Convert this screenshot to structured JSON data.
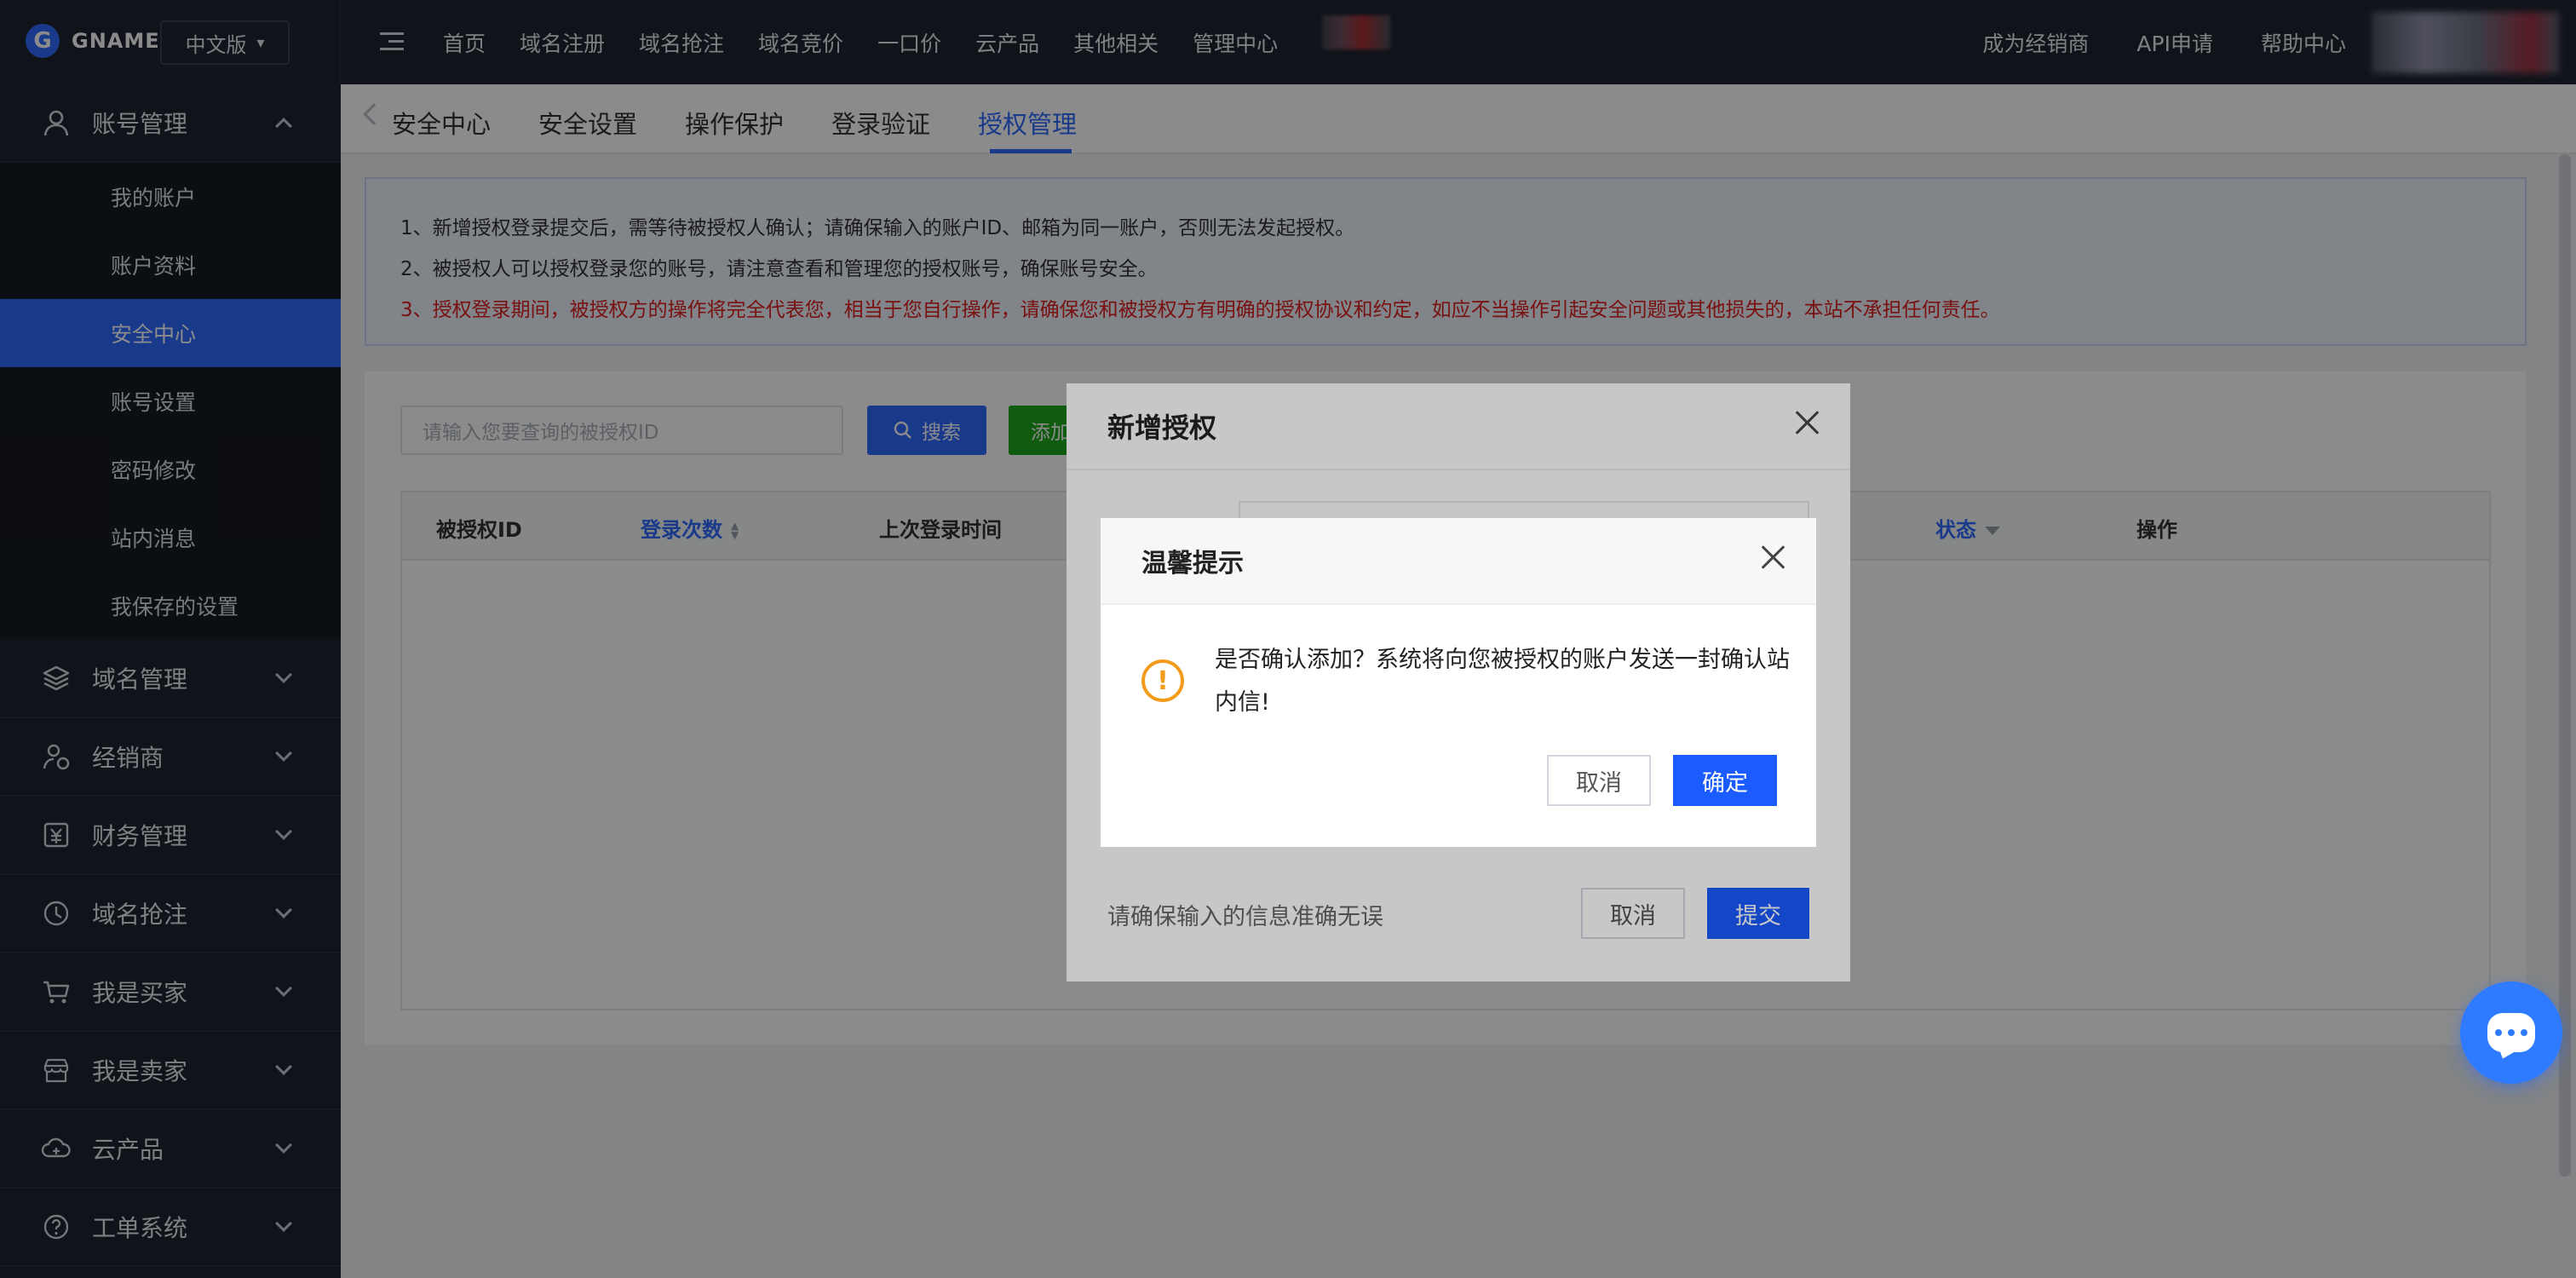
{
  "brand": {
    "logo_letter": "G",
    "name": "GNAME"
  },
  "language": {
    "selected": "中文版"
  },
  "topnav": {
    "items": [
      "首页",
      "域名注册",
      "域名抢注",
      "域名竞价",
      "一口价",
      "云产品",
      "其他相关",
      "管理中心"
    ],
    "right_items": [
      "成为经销商",
      "API申请",
      "帮助中心"
    ]
  },
  "sidebar": {
    "account_group": "账号管理",
    "sub_items": [
      "我的账户",
      "账户资料",
      "安全中心",
      "账号设置",
      "密码修改",
      "站内消息",
      "我保存的设置"
    ],
    "active_sub": "安全中心",
    "groups": [
      "域名管理",
      "经销商",
      "财务管理",
      "域名抢注",
      "我是买家",
      "我是卖家",
      "云产品",
      "工单系统"
    ]
  },
  "tabs": {
    "items": [
      "安全中心",
      "安全设置",
      "操作保护",
      "登录验证",
      "授权管理"
    ],
    "active": "授权管理"
  },
  "notice": {
    "line1": "1、新增授权登录提交后，需等待被授权人确认；请确保输入的账户ID、邮箱为同一账户，否则无法发起授权。",
    "line2": "2、被授权人可以授权登录您的账号，请注意查看和管理您的授权账号，确保账号安全。",
    "line3": "3、授权登录期间，被授权方的操作将完全代表您，相当于您自行操作，请确保您和被授权方有明确的授权协议和约定，如应不当操作引起安全问题或其他损失的，本站不承担任何责任。"
  },
  "search": {
    "placeholder": "请输入您要查询的被授权ID",
    "button": "搜索",
    "add_button": "添加"
  },
  "table": {
    "headers": {
      "id": "被授权ID",
      "login_count": "登录次数",
      "last_login": "上次登录时间",
      "status": "状态",
      "action": "操作"
    }
  },
  "modal_add": {
    "title": "新增授权",
    "footer_text": "请确保输入的信息准确无误",
    "cancel": "取消",
    "submit": "提交"
  },
  "modal_confirm": {
    "title": "温馨提示",
    "message": "是否确认添加？系统将向您被授权的账户发送一封确认站内信!",
    "cancel": "取消",
    "confirm": "确定"
  },
  "colors": {
    "accent": "#2f6bff",
    "sidebar_bg": "#1f2430",
    "danger_text": "#e02020",
    "warning": "#f39c1c",
    "success": "#1ea81e"
  }
}
